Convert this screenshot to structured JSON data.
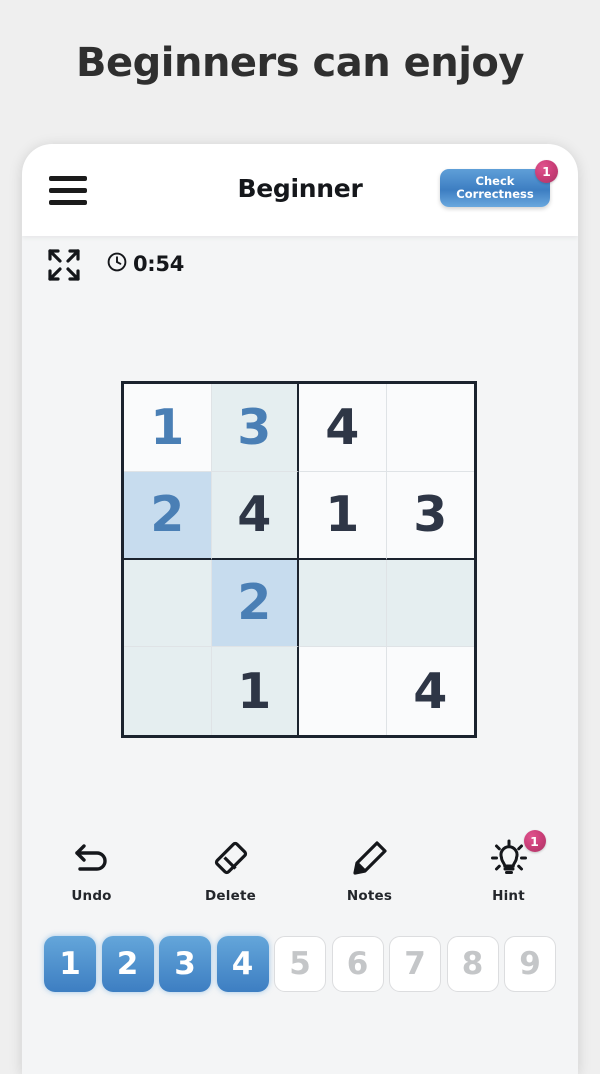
{
  "headline": "Beginners can enjoy",
  "appbar": {
    "menu_icon": "hamburger-menu-icon",
    "title": "Beginner",
    "check_button": {
      "line1": "Check",
      "line2": "Correctness",
      "badge": "1"
    }
  },
  "status": {
    "expand_icon": "fullscreen-expand-icon",
    "clock_icon": "clock-icon",
    "time": "0:54"
  },
  "board": {
    "size": 4,
    "cells": [
      {
        "value": "1",
        "type": "user",
        "bg": "plain"
      },
      {
        "value": "3",
        "type": "user",
        "bg": "tint"
      },
      {
        "value": "4",
        "type": "given",
        "bg": "plain"
      },
      {
        "value": "",
        "type": "empty",
        "bg": "plain"
      },
      {
        "value": "2",
        "type": "user",
        "bg": "sel"
      },
      {
        "value": "4",
        "type": "given",
        "bg": "tint"
      },
      {
        "value": "1",
        "type": "given",
        "bg": "plain"
      },
      {
        "value": "3",
        "type": "given",
        "bg": "plain"
      },
      {
        "value": "",
        "type": "empty",
        "bg": "tint"
      },
      {
        "value": "2",
        "type": "user",
        "bg": "sel"
      },
      {
        "value": "",
        "type": "empty",
        "bg": "tint"
      },
      {
        "value": "",
        "type": "empty",
        "bg": "tint"
      },
      {
        "value": "",
        "type": "empty",
        "bg": "tint"
      },
      {
        "value": "1",
        "type": "given",
        "bg": "tint"
      },
      {
        "value": "",
        "type": "empty",
        "bg": "plain"
      },
      {
        "value": "4",
        "type": "given",
        "bg": "plain"
      }
    ]
  },
  "tools": [
    {
      "label": "Undo",
      "icon": "undo-arrow-icon",
      "badge": ""
    },
    {
      "label": "Delete",
      "icon": "eraser-icon",
      "badge": ""
    },
    {
      "label": "Notes",
      "icon": "pencil-icon",
      "badge": ""
    },
    {
      "label": "Hint",
      "icon": "lightbulb-icon",
      "badge": "1"
    }
  ],
  "numpad": [
    {
      "label": "1",
      "state": "active"
    },
    {
      "label": "2",
      "state": "active"
    },
    {
      "label": "3",
      "state": "active"
    },
    {
      "label": "4",
      "state": "active"
    },
    {
      "label": "5",
      "state": "disabled"
    },
    {
      "label": "6",
      "state": "disabled"
    },
    {
      "label": "7",
      "state": "disabled"
    },
    {
      "label": "8",
      "state": "disabled"
    },
    {
      "label": "9",
      "state": "disabled"
    }
  ],
  "colors": {
    "page_bg": "#efefef",
    "card_bg": "#f4f5f6",
    "accent_blue": "#3d7ec2",
    "badge_pink": "#cc3f79",
    "given_ink": "#2e3646",
    "user_ink": "#4a7fb5",
    "cell_tint": "#e5eef0",
    "cell_selected": "#c7dcee",
    "grid_line": "#1b232e"
  }
}
